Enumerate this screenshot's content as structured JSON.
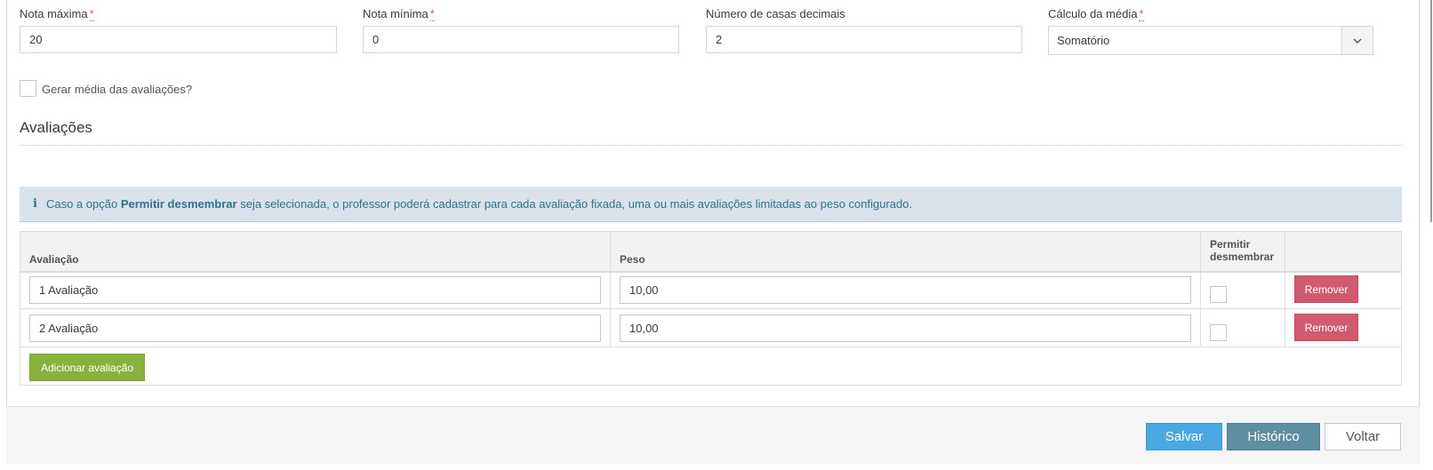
{
  "fields": {
    "nota_maxima": {
      "label": "Nota máxima",
      "required_mark": "*",
      "value": "20"
    },
    "nota_minima": {
      "label": "Nota mínima",
      "required_mark": "*",
      "value": "0"
    },
    "casas_decimais": {
      "label": "Número de casas decimais",
      "value": "2"
    },
    "calculo_media": {
      "label": "Cálculo da média",
      "required_mark": "*",
      "selected": "Somatório"
    }
  },
  "gerar_media": {
    "label": "Gerar média das avaliações?",
    "checked": false
  },
  "section": {
    "title": "Avaliações"
  },
  "info": {
    "icon": "info-icon",
    "text_before": "Caso a opção",
    "bold": "Permitir desmembrar",
    "text_after": "seja selecionada, o professor poderá cadastrar para cada avaliação fixada, uma ou mais avaliações limitadas ao peso configurado."
  },
  "table": {
    "headers": {
      "avaliacao": "Avaliação",
      "peso": "Peso",
      "permitir_line1": "Permitir",
      "permitir_line2": "desmembrar"
    },
    "rows": [
      {
        "avaliacao": "1 Avaliação",
        "peso": "10,00",
        "permitir": false,
        "remove_label": "Remover"
      },
      {
        "avaliacao": "2 Avaliação",
        "peso": "10,00",
        "permitir": false,
        "remove_label": "Remover"
      }
    ],
    "add_label": "Adicionar avaliação"
  },
  "footer": {
    "save_label": "Salvar",
    "history_label": "Histórico",
    "back_label": "Voltar"
  },
  "colors": {
    "required": "#d15b47",
    "info_bg": "#d9e2ea",
    "remove": "#d15b6e",
    "add": "#87b33c",
    "save": "#4ca8e0",
    "history": "#5d8fa0"
  }
}
